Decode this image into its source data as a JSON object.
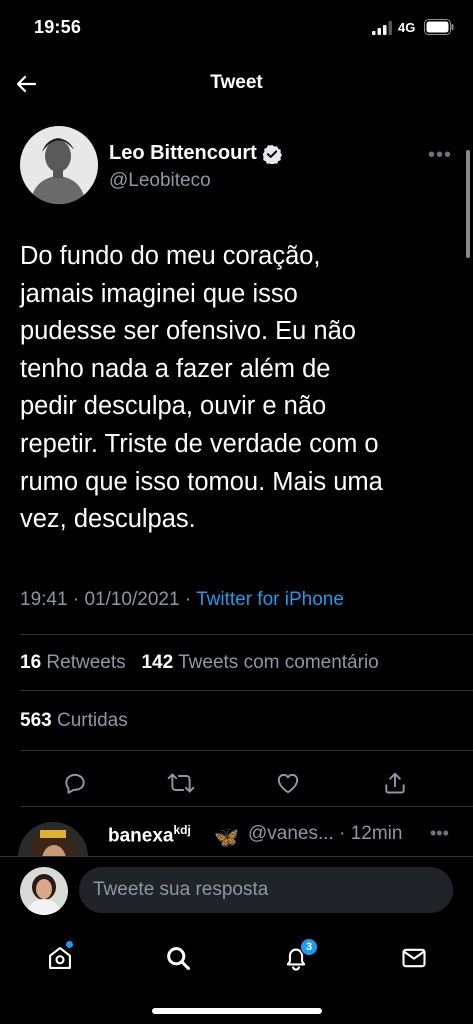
{
  "status_bar": {
    "time": "19:56",
    "network": "4G"
  },
  "nav": {
    "title": "Tweet"
  },
  "tweet": {
    "author_name": "Leo Bittencourt",
    "handle": "@Leobiteco",
    "text": "Do fundo do meu coração,\njamais imaginei que isso\npudesse ser ofensivo. Eu não\ntenho nada a fazer além de\npedir desculpa, ouvir e não\nrepetir. Triste de verdade com o\nrumo que isso tomou. Mais uma\nvez, desculpas.",
    "time": "19:41",
    "date": "01/10/2021",
    "separator": "·",
    "source": "Twitter for iPhone"
  },
  "stats": {
    "retweets_count": "16",
    "retweets_label": "Retweets",
    "quotes_count": "142",
    "quotes_label": "Tweets com comentário",
    "likes_count": "563",
    "likes_label": "Curtidas"
  },
  "actions": {
    "icons": [
      "reply-icon",
      "retweet-icon",
      "like-icon",
      "share-icon"
    ]
  },
  "reply_preview": {
    "name": "banexa",
    "name_sup": "kdj",
    "emoji": "🦋",
    "handle": "@vanes...",
    "time": "12min",
    "separator": "·"
  },
  "compose": {
    "placeholder": "Tweete sua resposta"
  },
  "tab_bar": {
    "icons": [
      "home-icon",
      "search-icon",
      "notifications-icon",
      "messages-icon"
    ],
    "notifications_badge": "3"
  },
  "colors": {
    "accent": "#1d9bf0",
    "background": "#000000",
    "secondary_text": "#8b98a5"
  }
}
